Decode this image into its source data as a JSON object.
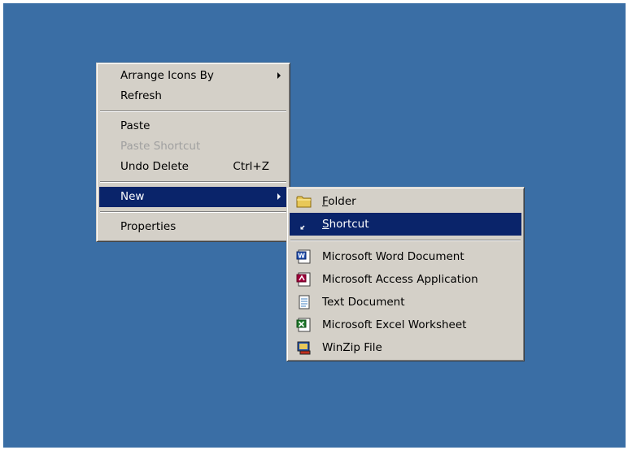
{
  "context_menu": {
    "items": [
      {
        "label": "Arrange Icons By"
      },
      {
        "label": "Refresh"
      },
      {
        "label": "Paste"
      },
      {
        "label": "Paste Shortcut"
      },
      {
        "label": "Undo Delete",
        "shortcut": "Ctrl+Z"
      },
      {
        "label": "New"
      },
      {
        "label": "Properties"
      }
    ]
  },
  "new_submenu": {
    "items": [
      {
        "label_first": "F",
        "label_rest": "older",
        "icon": "folder-icon"
      },
      {
        "label_first": "S",
        "label_rest": "hortcut",
        "icon": "shortcut-icon"
      },
      {
        "label": "Microsoft Word Document",
        "icon": "word-icon"
      },
      {
        "label": "Microsoft Access Application",
        "icon": "access-icon"
      },
      {
        "label": "Text Document",
        "icon": "text-document-icon"
      },
      {
        "label": "Microsoft Excel Worksheet",
        "icon": "excel-icon"
      },
      {
        "label": "WinZip File",
        "icon": "winzip-icon"
      }
    ]
  },
  "colors": {
    "desktop": "#3a6ea5",
    "menu_face": "#d4d0c8",
    "highlight": "#0a246a",
    "disabled_text": "#a0a0a0"
  }
}
